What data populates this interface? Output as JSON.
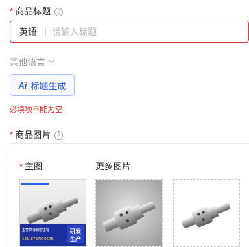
{
  "title_field": {
    "required_mark": "*",
    "label": "商品标题",
    "help": "?",
    "lang_label": "英语",
    "placeholder": "请输入标题",
    "value": ""
  },
  "other_languages": {
    "label": "其他语言"
  },
  "generate_button": {
    "ai_label": "Ai",
    "label": "标题生成"
  },
  "error": {
    "message": "必填项不能为空"
  },
  "images_field": {
    "required_mark": "*",
    "label": "商品图片",
    "help": "?",
    "main_required_mark": "*",
    "main_label": "主图",
    "more_label": "更多图片"
  },
  "main_image_banner": {
    "line1": "主营高速精密主轴",
    "phone": "131-6787X-8605",
    "badge_line1": "研发",
    "badge_line2": "生产"
  },
  "colors": {
    "accent": "#2f5fe8",
    "error": "#e02020",
    "banner": "#1c2f9c"
  }
}
